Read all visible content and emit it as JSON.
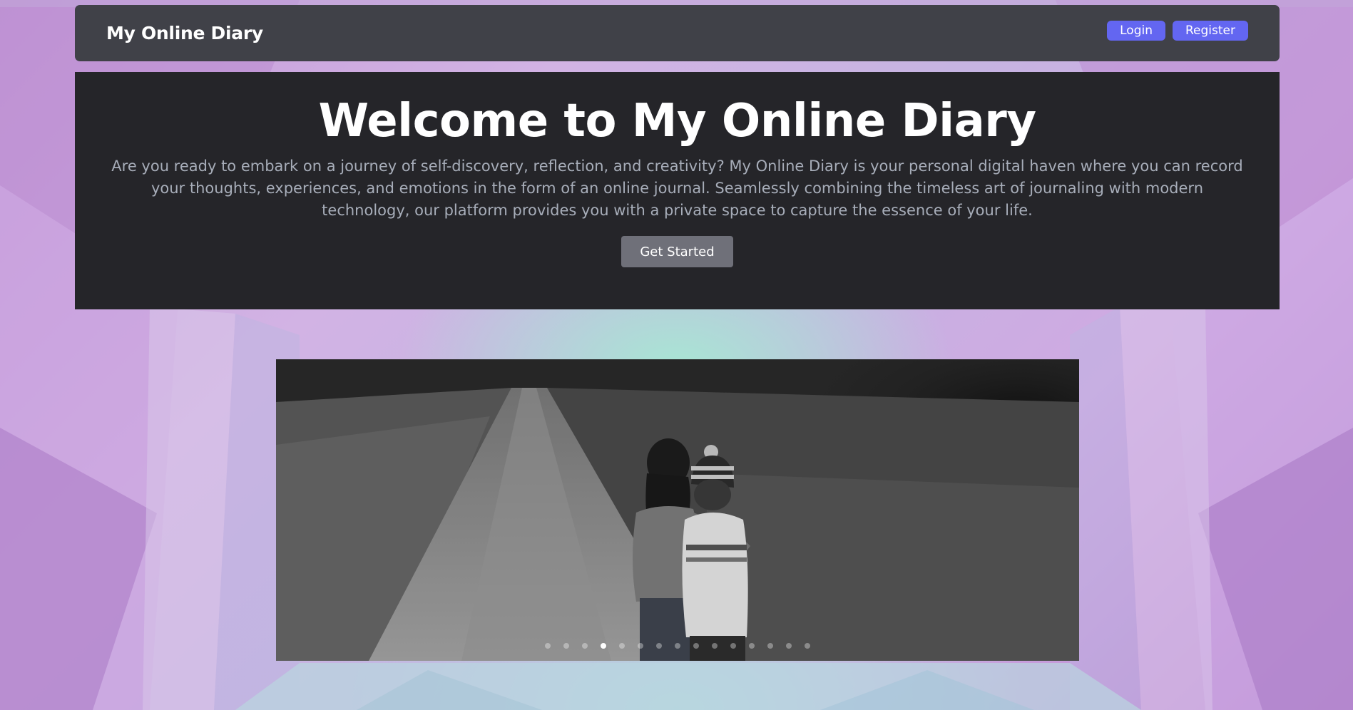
{
  "navbar": {
    "brand": "My Online Diary",
    "login_label": "Login",
    "register_label": "Register"
  },
  "hero": {
    "title": "Welcome to My Online Diary",
    "text": "Are you ready to embark on a journey of self-discovery, reflection, and creativity? My Online Diary is your personal digital haven where you can record your thoughts, experiences, and emotions in the form of an online journal. Seamlessly combining the timeless art of journaling with modern technology, our platform provides you with a private space to capture the essence of your life.",
    "cta_label": "Get Started"
  },
  "carousel": {
    "slide_count": 15,
    "active_index": 3,
    "image_description_icon": "photo-children-walking-path"
  },
  "colors": {
    "accent": "#6366f1",
    "navbar_bg": "#404148",
    "hero_bg": "#252529",
    "hero_text": "#a7adb9",
    "cta_bg": "#6f7079"
  }
}
